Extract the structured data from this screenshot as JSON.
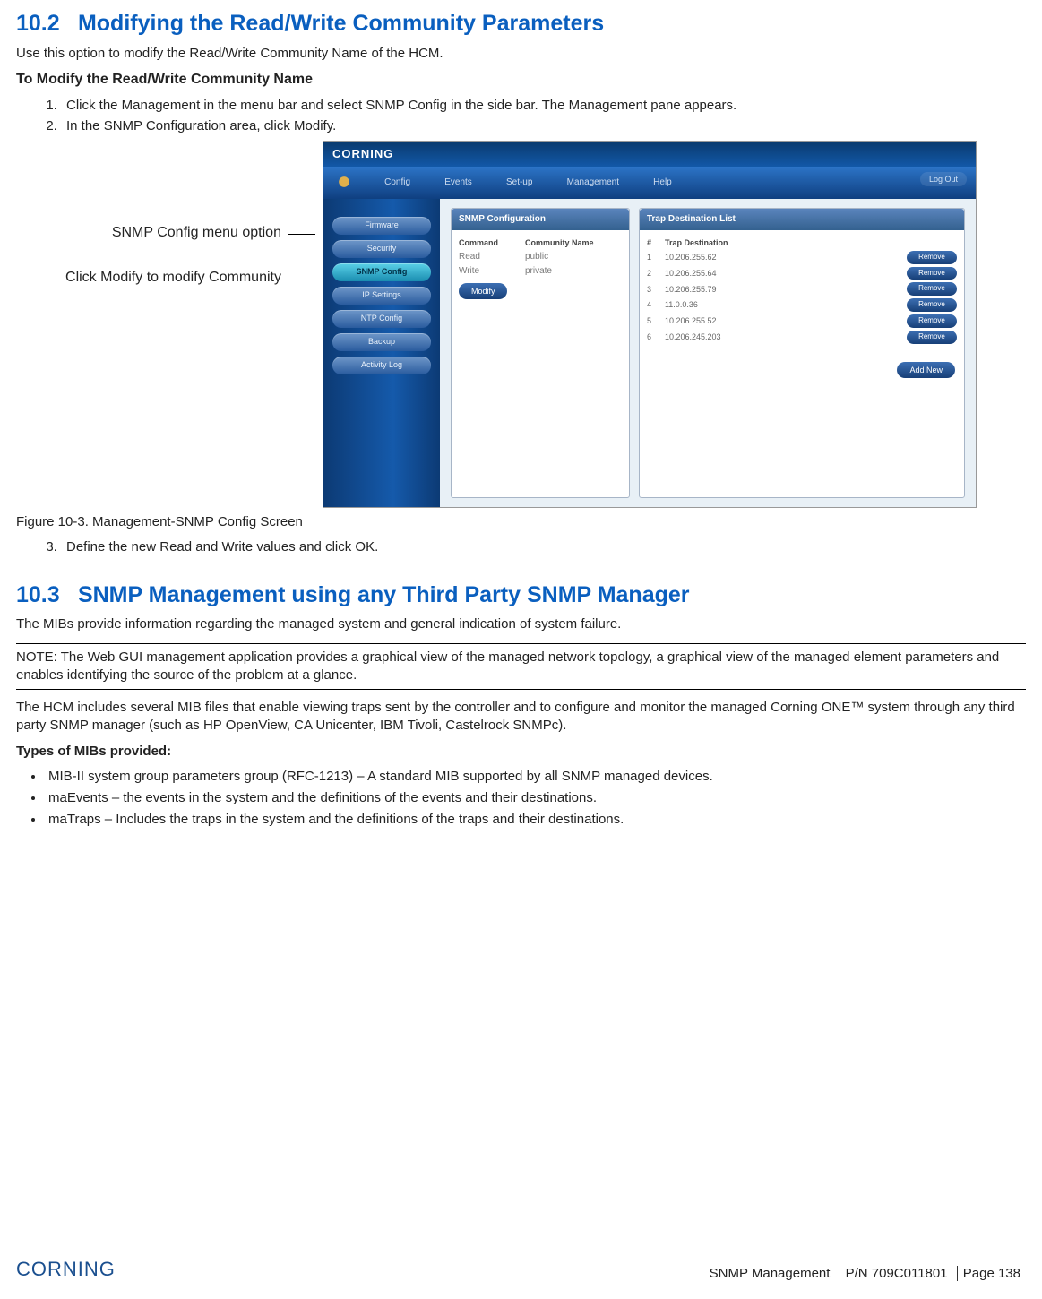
{
  "section102": {
    "num": "10.2",
    "title": "Modifying the Read/Write Community Parameters",
    "intro": "Use this option to modify the Read/Write Community Name of the HCM.",
    "subhead": "To Modify the Read/Write Community Name",
    "steps": [
      "Click the Management in the menu bar and select SNMP Config in the side bar. The Management pane appears.",
      "In the SNMP Configuration area, click Modify."
    ],
    "step3": "Define the new Read and Write values and click OK.",
    "figcap": "Figure 10-3. Management-SNMP Config Screen"
  },
  "annotations": {
    "a1": "SNMP Config menu option",
    "a2": "Click Modify to modify Community"
  },
  "screenshot": {
    "brand": "CORNING",
    "nav": [
      "Config",
      "Events",
      "Set-up",
      "Management",
      "Help"
    ],
    "logout": "Log Out",
    "sidebar": [
      "Firmware",
      "Security",
      "SNMP Config",
      "IP Settings",
      "NTP Config",
      "Backup",
      "Activity Log"
    ],
    "pane1": {
      "title": "SNMP Configuration",
      "hdr1": "Command",
      "hdr2": "Community Name",
      "r1c1": "Read",
      "r1c2": "public",
      "r2c1": "Write",
      "r2c2": "private",
      "modify": "Modify"
    },
    "pane2": {
      "title": "Trap Destination List",
      "hdrNum": "#",
      "hdrDest": "Trap Destination",
      "rows": [
        {
          "n": "1",
          "d": "10.206.255.62"
        },
        {
          "n": "2",
          "d": "10.206.255.64"
        },
        {
          "n": "3",
          "d": "10.206.255.79"
        },
        {
          "n": "4",
          "d": "11.0.0.36"
        },
        {
          "n": "5",
          "d": "10.206.255.52"
        },
        {
          "n": "6",
          "d": "10.206.245.203"
        }
      ],
      "remove": "Remove",
      "addnew": "Add New"
    }
  },
  "section103": {
    "num": "10.3",
    "title": "SNMP Management using any Third Party SNMP Manager",
    "p1": "The MIBs provide information regarding the managed system and general indication of system failure.",
    "note": "NOTE: The Web GUI management application provides a graphical view of the managed network topology, a graphical view of the managed element parameters and enables identifying the source of the problem at a glance.",
    "p2": "The HCM includes several MIB files that enable viewing traps sent by the controller and to configure and monitor the managed Corning ONE™ system through any third party SNMP manager (such as HP OpenView, CA Unicenter, IBM Tivoli, Castelrock SNMPc).",
    "typesHead": "Types of MIBs provided:",
    "bullets": [
      "MIB-II system group parameters group (RFC-1213) – A standard MIB supported by all SNMP managed devices.",
      "maEvents – the events in the system and the definitions of the events and their destinations.",
      "maTraps – Includes the traps in the system and the definitions of the traps and their destinations."
    ]
  },
  "footer": {
    "logo": "CORNING",
    "chapter": "SNMP Management",
    "pn": "P/N 709C011801",
    "page": "Page 138"
  }
}
